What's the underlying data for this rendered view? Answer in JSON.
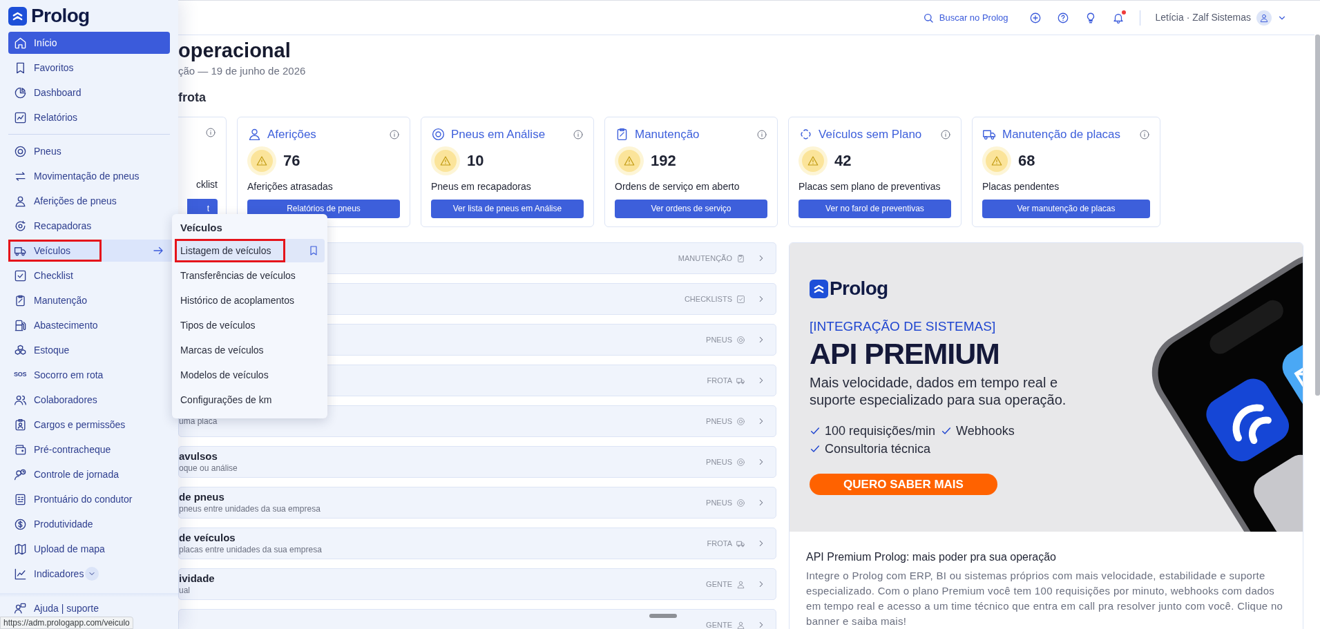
{
  "sidebar": {
    "logo": "Prolog",
    "groups": [
      [
        {
          "label": "Início",
          "kind": "link",
          "selected": true,
          "annotated": false
        },
        {
          "label": "Favoritos",
          "kind": "link",
          "selected": false,
          "annotated": false
        },
        {
          "label": "Dashboard",
          "kind": "link",
          "selected": false,
          "annotated": false
        },
        {
          "label": "Relatórios",
          "kind": "link",
          "selected": false,
          "annotated": false
        }
      ],
      [
        {
          "label": "Pneus",
          "kind": "link",
          "selected": false,
          "annotated": false
        },
        {
          "label": "Movimentação de pneus",
          "kind": "link",
          "selected": false,
          "annotated": false
        },
        {
          "label": "Aferições de pneus",
          "kind": "link",
          "selected": false,
          "annotated": false
        },
        {
          "label": "Recapadoras",
          "kind": "link",
          "selected": false,
          "annotated": false
        },
        {
          "label": "Veículos",
          "kind": "flyout",
          "selected": false,
          "annotated": true
        },
        {
          "label": "Checklist",
          "kind": "link",
          "selected": false,
          "annotated": false
        },
        {
          "label": "Manutenção",
          "kind": "link",
          "selected": false,
          "annotated": false
        },
        {
          "label": "Abastecimento",
          "kind": "link",
          "selected": false,
          "annotated": false
        },
        {
          "label": "Estoque",
          "kind": "link",
          "selected": false,
          "annotated": false
        },
        {
          "label": "Socorro em rota",
          "kind": "link",
          "selected": false,
          "annotated": false,
          "icon_text": "SOS"
        },
        {
          "label": "Colaboradores",
          "kind": "link",
          "selected": false,
          "annotated": false
        },
        {
          "label": "Cargos e permissões",
          "kind": "link",
          "selected": false,
          "annotated": false
        },
        {
          "label": "Pré-contracheque",
          "kind": "link",
          "selected": false,
          "annotated": false
        },
        {
          "label": "Controle de jornada",
          "kind": "link",
          "selected": false,
          "annotated": false
        },
        {
          "label": "Prontuário do condutor",
          "kind": "link",
          "selected": false,
          "annotated": false
        },
        {
          "label": "Produtividade",
          "kind": "link",
          "selected": false,
          "annotated": false
        },
        {
          "label": "Upload de mapa",
          "kind": "link",
          "selected": false,
          "annotated": false
        },
        {
          "label": "Indicadores",
          "kind": "expandable",
          "selected": false,
          "annotated": false
        }
      ]
    ],
    "help": "Ajuda | suporte"
  },
  "flyout": {
    "title": "Veículos",
    "items": [
      {
        "label": "Listagem de veículos",
        "selected": true,
        "annotated": true
      },
      {
        "label": "Transferências de veículos",
        "selected": false,
        "annotated": false
      },
      {
        "label": "Histórico de acoplamentos",
        "selected": false,
        "annotated": false
      },
      {
        "label": "Tipos de veículos",
        "selected": false,
        "annotated": false
      },
      {
        "label": "Marcas de veículos",
        "selected": false,
        "annotated": false
      },
      {
        "label": "Modelos de veículos",
        "selected": false,
        "annotated": false
      },
      {
        "label": "Configurações de km",
        "selected": false,
        "annotated": false
      }
    ]
  },
  "header": {
    "search": "Buscar no Prolog",
    "unread_notifications": true,
    "user": "Letícia · Zalf Sistemas"
  },
  "page": {
    "title": "operacional",
    "subtitle": "ção — 19 de junho de 2026",
    "section": "frota"
  },
  "cards": [
    {
      "kind": "partial",
      "caption": "cklist",
      "button": "t"
    },
    {
      "kind": "full",
      "title": "Aferições",
      "count": "76",
      "caption": "Aferições atrasadas",
      "button": "Relatórios de pneus"
    },
    {
      "kind": "full",
      "title": "Pneus em Análise",
      "count": "10",
      "caption": "Pneus em recapadoras",
      "button": "Ver lista de pneus em Análise"
    },
    {
      "kind": "full",
      "title": "Manutenção",
      "count": "192",
      "caption": "Ordens de serviço em aberto",
      "button": "Ver ordens de serviço"
    },
    {
      "kind": "full",
      "title": "Veículos sem Plano",
      "count": "42",
      "caption": "Placas sem plano de preventivas",
      "button": "Ver no farol de preventivas"
    },
    {
      "kind": "full",
      "title": "Manutenção de placas",
      "count": "68",
      "caption": "Placas pendentes",
      "button": "Ver manutenção de placas"
    }
  ],
  "rows": [
    {
      "tag": "MANUTENÇÃO",
      "kind": "maintenance"
    },
    {
      "tag": "CHECKLISTS",
      "kind": "checklist"
    },
    {
      "tag": "PNEUS",
      "kind": "tires"
    },
    {
      "tag": "FROTA",
      "kind": "fleet"
    },
    {
      "subtitle": "uma placa",
      "tag": "PNEUS",
      "kind": "tires"
    },
    {
      "title": "avulsos",
      "subtitle": "oque ou análise",
      "tag": "PNEUS",
      "kind": "tires"
    },
    {
      "title": "de pneus",
      "subtitle": "pneus entre unidades da sua empresa",
      "tag": "PNEUS",
      "kind": "tires"
    },
    {
      "title": "de veículos",
      "subtitle": "placas entre unidades da sua empresa",
      "tag": "FROTA",
      "kind": "fleet"
    },
    {
      "title": "ividade",
      "subtitle": "ual",
      "tag": "GENTE",
      "kind": "people"
    },
    {
      "tag": "GENTE",
      "kind": "people"
    }
  ],
  "banner": {
    "logo": "Prolog",
    "eyebrow": "[INTEGRAÇÃO DE SISTEMAS]",
    "headline": "API PREMIUM",
    "lead": "Mais velocidade, dados em tempo real e suporte especializado para sua operação.",
    "features": [
      "100 requisições/min",
      "Webhooks",
      "Consultoria técnica"
    ],
    "cta": "QUERO SABER MAIS",
    "caption_title": "API Premium Prolog: mais poder pra sua operação",
    "caption_body": "Integre o Prolog com ERP, BI ou sistemas próprios com mais velocidade, estabilidade e suporte especializado. Com o plano Premium você tem 100 requisições por minuto, webhooks com dados em tempo real e acesso a um time técnico que entra em call pra resolver junto com você. Clique no banner e saiba mais!"
  },
  "status_url": "https://adm.prologapp.com/veiculo"
}
